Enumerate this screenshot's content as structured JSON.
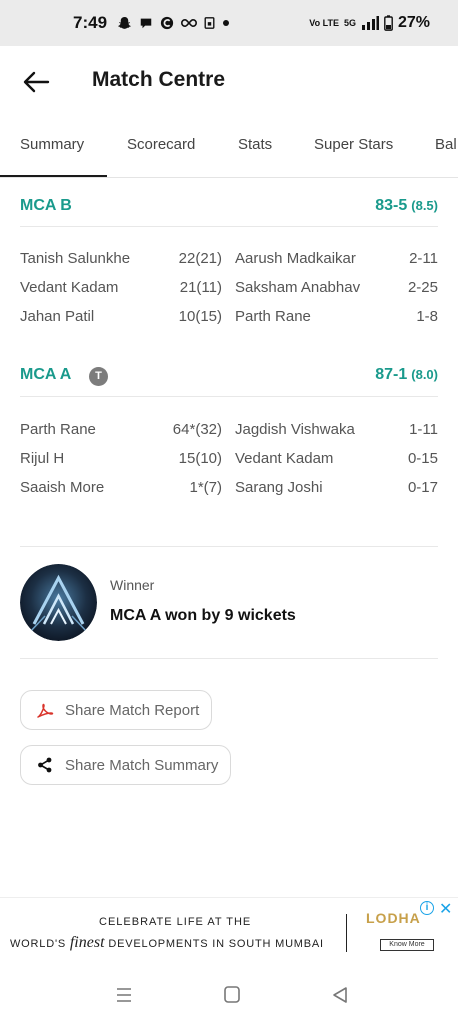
{
  "status_bar": {
    "time": "7:49",
    "network": "Vo LTE",
    "signal": "5G",
    "battery": "27%"
  },
  "header": {
    "title": "Match Centre"
  },
  "tabs": [
    {
      "label": "Summary",
      "active": true
    },
    {
      "label": "Scorecard",
      "active": false
    },
    {
      "label": "Stats",
      "active": false
    },
    {
      "label": "Super Stars",
      "active": false
    },
    {
      "label": "Bal",
      "active": false
    }
  ],
  "innings": [
    {
      "team": "MCA B",
      "badge": "",
      "score": "83-5",
      "overs": "(8.5)",
      "rows": [
        {
          "batter": "Tanish Salunkhe",
          "bat_score": "22(21)",
          "bowler": "Aarush Madkaikar",
          "bowl_figs": "2-11"
        },
        {
          "batter": "Vedant Kadam",
          "bat_score": "21(11)",
          "bowler": "Saksham Anabhav",
          "bowl_figs": "2-25"
        },
        {
          "batter": "Jahan Patil",
          "bat_score": "10(15)",
          "bowler": "Parth Rane",
          "bowl_figs": "1-8"
        }
      ]
    },
    {
      "team": "MCA A",
      "badge": "T",
      "score": "87-1",
      "overs": "(8.0)",
      "rows": [
        {
          "batter": "Parth Rane",
          "bat_score": "64*(32)",
          "bowler": "Jagdish Vishwaka",
          "bowl_figs": "1-11"
        },
        {
          "batter": "Rijul H",
          "bat_score": "15(10)",
          "bowler": "Vedant Kadam",
          "bowl_figs": "0-15"
        },
        {
          "batter": "Saaish More",
          "bat_score": "1*(7)",
          "bowler": "Sarang Joshi",
          "bowl_figs": "0-17"
        }
      ]
    }
  ],
  "result": {
    "label": "Winner",
    "text": "MCA A won by 9 wickets"
  },
  "actions": {
    "share_report": "Share Match Report",
    "share_summary": "Share Match Summary"
  },
  "ad": {
    "line1": "CELEBRATE LIFE AT THE",
    "line2_pre": "WORLD'S ",
    "line2_em": "finest",
    "line2_post": " DEVELOPMENTS IN SOUTH MUMBAI",
    "brand": "LODHA",
    "cta": "Know More"
  },
  "colors": {
    "team_accent": "#1a9a8c",
    "badge": "#7c7c7c",
    "pdf_icon": "#d9342b"
  }
}
